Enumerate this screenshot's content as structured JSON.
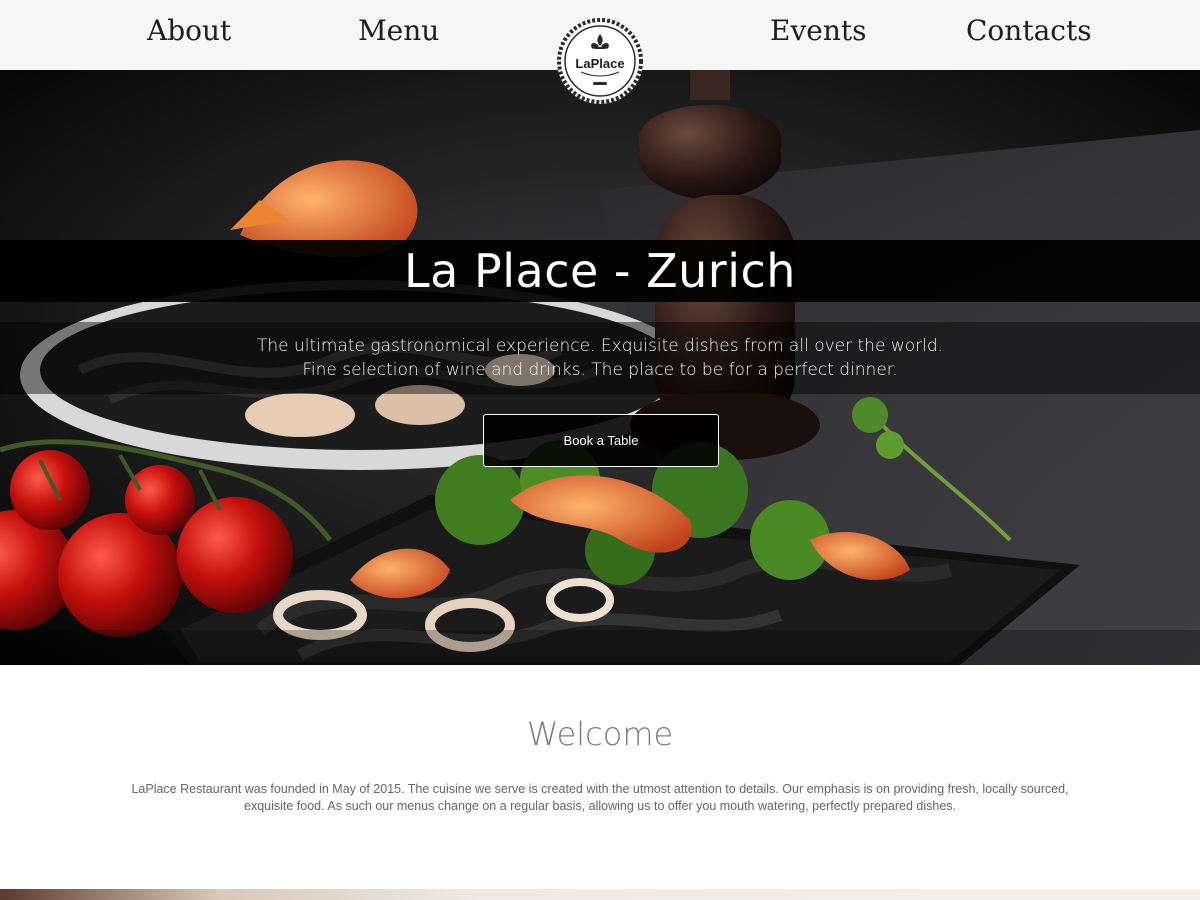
{
  "nav": {
    "about": "About",
    "menu": "Menu",
    "events": "Events",
    "contacts": "Contacts"
  },
  "logo": {
    "name": "LaPlace",
    "icon": "fleur-de-lis-icon"
  },
  "hero": {
    "title": "La Place - Zurich",
    "subtitle_line1": "The ultimate gastronomical experience. Exquisite dishes from all over the world.",
    "subtitle_line2": "Fine selection of wine and drinks. The place to be for a perfect dinner.",
    "button_label": "Book a Table"
  },
  "welcome": {
    "heading": "Welcome",
    "text": "LaPlace Restaurant was founded in May of 2015. The cuisine we serve is created with the utmost attention to details. Our emphasis is on providing fresh, locally sourced, exquisite food. As such our menus change on a regular basis, allowing us to offer you mouth watering, perfectly prepared dishes."
  },
  "colors": {
    "nav_bg": "#f6f6f6",
    "nav_text": "#1e1e1e",
    "hero_text": "#ffffff",
    "welcome_heading": "#7c7c7c",
    "welcome_text": "#666666"
  }
}
